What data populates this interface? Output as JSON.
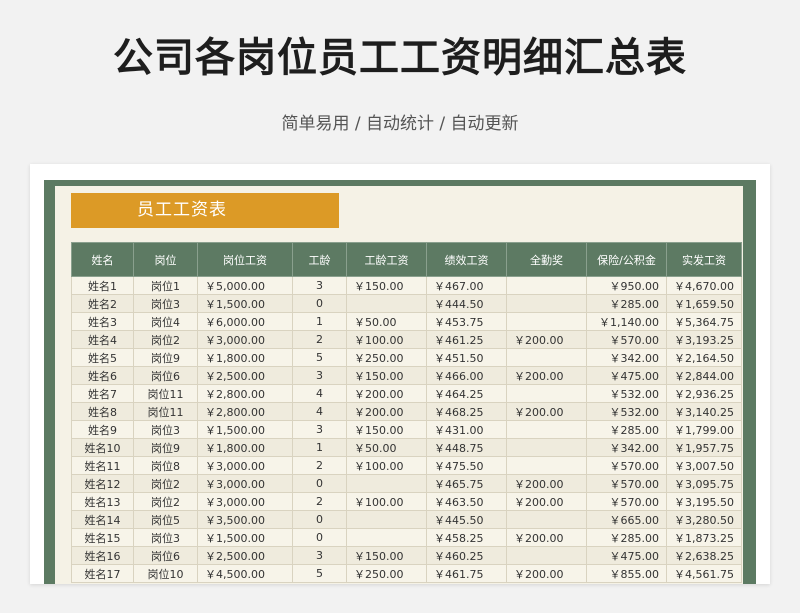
{
  "page": {
    "title": "公司各岗位员工工资明细汇总表",
    "subtitle": "简单易用 / 自动统计 / 自动更新"
  },
  "colors": {
    "background": "#f2f2f2",
    "frame_green": "#5c7a62",
    "header_green": "#5d7a63",
    "title_orange": "#dc9a26",
    "sheet_cream": "#f5f2e6"
  },
  "sheet": {
    "title": "员工工资表",
    "columns": [
      "姓名",
      "岗位",
      "岗位工资",
      "工龄",
      "工龄工资",
      "绩效工资",
      "全勤奖",
      "保险/公积金",
      "实发工资"
    ],
    "rows": [
      [
        "姓名1",
        "岗位1",
        "￥5,000.00",
        "3",
        "￥150.00",
        "￥467.00",
        "",
        "￥950.00",
        "￥4,670.00"
      ],
      [
        "姓名2",
        "岗位3",
        "￥1,500.00",
        "0",
        "",
        "￥444.50",
        "",
        "￥285.00",
        "￥1,659.50"
      ],
      [
        "姓名3",
        "岗位4",
        "￥6,000.00",
        "1",
        "￥50.00",
        "￥453.75",
        "",
        "￥1,140.00",
        "￥5,364.75"
      ],
      [
        "姓名4",
        "岗位2",
        "￥3,000.00",
        "2",
        "￥100.00",
        "￥461.25",
        "￥200.00",
        "￥570.00",
        "￥3,193.25"
      ],
      [
        "姓名5",
        "岗位9",
        "￥1,800.00",
        "5",
        "￥250.00",
        "￥451.50",
        "",
        "￥342.00",
        "￥2,164.50"
      ],
      [
        "姓名6",
        "岗位6",
        "￥2,500.00",
        "3",
        "￥150.00",
        "￥466.00",
        "￥200.00",
        "￥475.00",
        "￥2,844.00"
      ],
      [
        "姓名7",
        "岗位11",
        "￥2,800.00",
        "4",
        "￥200.00",
        "￥464.25",
        "",
        "￥532.00",
        "￥2,936.25"
      ],
      [
        "姓名8",
        "岗位11",
        "￥2,800.00",
        "4",
        "￥200.00",
        "￥468.25",
        "￥200.00",
        "￥532.00",
        "￥3,140.25"
      ],
      [
        "姓名9",
        "岗位3",
        "￥1,500.00",
        "3",
        "￥150.00",
        "￥431.00",
        "",
        "￥285.00",
        "￥1,799.00"
      ],
      [
        "姓名10",
        "岗位9",
        "￥1,800.00",
        "1",
        "￥50.00",
        "￥448.75",
        "",
        "￥342.00",
        "￥1,957.75"
      ],
      [
        "姓名11",
        "岗位8",
        "￥3,000.00",
        "2",
        "￥100.00",
        "￥475.50",
        "",
        "￥570.00",
        "￥3,007.50"
      ],
      [
        "姓名12",
        "岗位2",
        "￥3,000.00",
        "0",
        "",
        "￥465.75",
        "￥200.00",
        "￥570.00",
        "￥3,095.75"
      ],
      [
        "姓名13",
        "岗位2",
        "￥3,000.00",
        "2",
        "￥100.00",
        "￥463.50",
        "￥200.00",
        "￥570.00",
        "￥3,195.50"
      ],
      [
        "姓名14",
        "岗位5",
        "￥3,500.00",
        "0",
        "",
        "￥445.50",
        "",
        "￥665.00",
        "￥3,280.50"
      ],
      [
        "姓名15",
        "岗位3",
        "￥1,500.00",
        "0",
        "",
        "￥458.25",
        "￥200.00",
        "￥285.00",
        "￥1,873.25"
      ],
      [
        "姓名16",
        "岗位6",
        "￥2,500.00",
        "3",
        "￥150.00",
        "￥460.25",
        "",
        "￥475.00",
        "￥2,638.25"
      ],
      [
        "姓名17",
        "岗位10",
        "￥4,500.00",
        "5",
        "￥250.00",
        "￥461.75",
        "￥200.00",
        "￥855.00",
        "￥4,561.75"
      ]
    ]
  }
}
